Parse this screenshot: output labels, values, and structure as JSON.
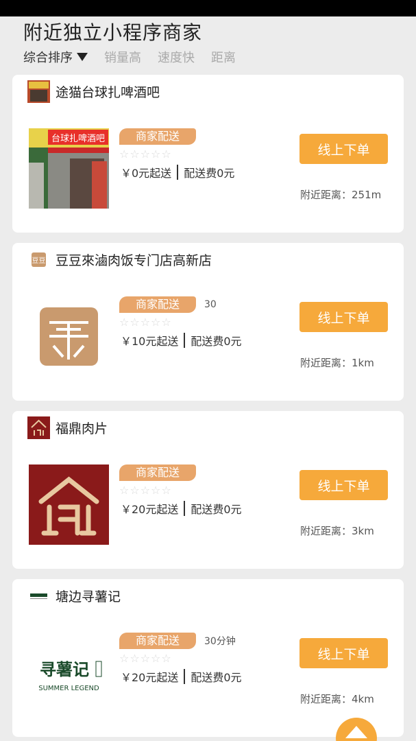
{
  "header": {
    "title": "附近独立小程序商家"
  },
  "sort": {
    "items": [
      "综合排序",
      "销量高",
      "速度快",
      "距离"
    ]
  },
  "shops": [
    {
      "name": "途猫台球扎啤酒吧",
      "tag": "商家配送",
      "extra": "",
      "stars": "☆☆☆☆☆",
      "min_order": "￥0元起送",
      "delivery_fee": "配送费0元",
      "button": "线上下单",
      "distance": "附近距离：251m",
      "logo_text": "途猫台球扎啤酒吧"
    },
    {
      "name": "豆豆來滷肉饭专门店高新店",
      "tag": "商家配送",
      "extra": "30",
      "stars": "☆☆☆☆☆",
      "min_order": "￥10元起送",
      "delivery_fee": "配送费0元",
      "button": "线上下单",
      "distance": "附近距离：1km",
      "logo_text": "豆豆來"
    },
    {
      "name": "福鼎肉片",
      "tag": "商家配送",
      "extra": "",
      "stars": "☆☆☆☆☆",
      "min_order": "￥20元起送",
      "delivery_fee": "配送费0元",
      "button": "线上下单",
      "distance": "附近距离：3km",
      "logo_text": "鼎"
    },
    {
      "name": "塘边寻薯记",
      "tag": "商家配送",
      "extra": "30分钟",
      "stars": "☆☆☆☆☆",
      "min_order": "￥20元起送",
      "delivery_fee": "配送费0元",
      "button": "线上下单",
      "distance": "附近距离：4km",
      "logo_text": "寻薯记",
      "logo_subtext": "SUMMER LEGEND"
    }
  ],
  "colors": {
    "accent": "#f6a93b",
    "tag": "#e8a56a",
    "status_bar": "#000000"
  }
}
